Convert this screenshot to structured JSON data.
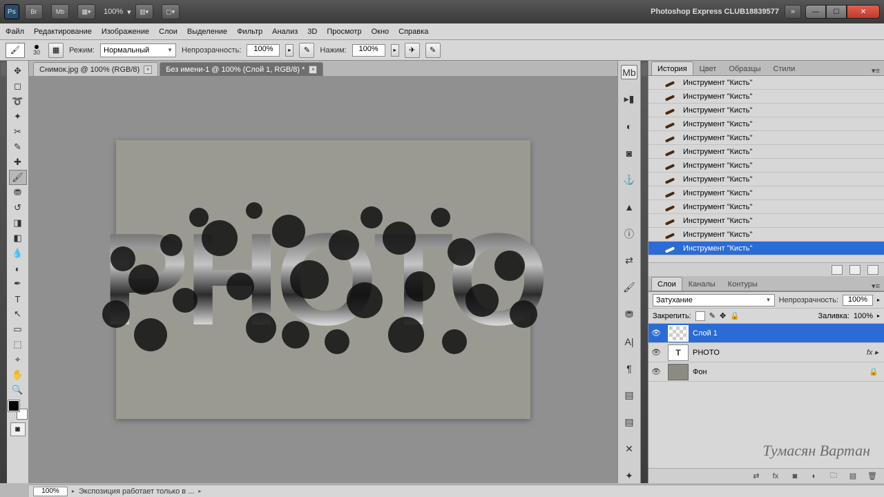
{
  "title": {
    "app": "Photoshop Express CLUB18839577",
    "ps": "Ps",
    "br": "Br",
    "mb": "Mb",
    "zoom": "100%"
  },
  "menu": [
    "Файл",
    "Редактирование",
    "Изображение",
    "Слои",
    "Выделение",
    "Фильтр",
    "Анализ",
    "3D",
    "Просмотр",
    "Окно",
    "Справка"
  ],
  "opt": {
    "brush_size": "30",
    "mode_label": "Режим:",
    "mode_value": "Нормальный",
    "opacity_label": "Непрозрачность:",
    "opacity_value": "100%",
    "flow_label": "Нажим:",
    "flow_value": "100%"
  },
  "tabs": [
    {
      "label": "Снимок.jpg @ 100% (RGB/8)",
      "active": false
    },
    {
      "label": "Без имени-1 @ 100% (Слой 1, RGB/8) *",
      "active": true
    }
  ],
  "canvas_text": "PHOTO",
  "history": {
    "tabs": [
      "История",
      "Цвет",
      "Образцы",
      "Стили"
    ],
    "active_tab": 0,
    "item": "Инструмент \"Кисть\"",
    "count": 13
  },
  "layers": {
    "tabs": [
      "Слои",
      "Каналы",
      "Контуры"
    ],
    "active_tab": 0,
    "blend": "Затухание",
    "opacity_label": "Непрозрачность:",
    "opacity_value": "100%",
    "lock_label": "Закрепить:",
    "fill_label": "Заливка:",
    "fill_value": "100%",
    "rows": [
      {
        "name": "Слой 1",
        "kind": "checker",
        "selected": true
      },
      {
        "name": "PHOTO",
        "kind": "t",
        "fx": "fx ▸"
      },
      {
        "name": "Фон",
        "kind": "solid",
        "lock": "🔒"
      }
    ]
  },
  "status": {
    "zoom": "100%",
    "text": "Экспозиция работает только в ..."
  },
  "watermark": "Тумасян Вартан"
}
